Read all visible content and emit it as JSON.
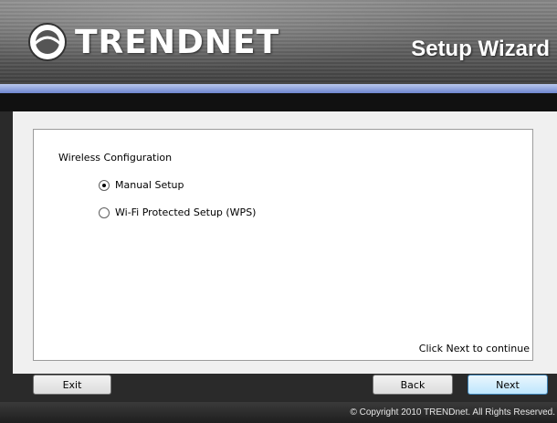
{
  "header": {
    "brand": "TRENDNET",
    "title": "Setup Wizard"
  },
  "wizard": {
    "section_title": "Wireless Configuration",
    "options": [
      {
        "label": "Manual Setup",
        "selected": true
      },
      {
        "label": "Wi-Fi Protected Setup (WPS)",
        "selected": false
      }
    ],
    "hint": "Click Next to continue"
  },
  "buttons": {
    "exit": "Exit",
    "back": "Back",
    "next": "Next"
  },
  "footer": {
    "copyright": "© Copyright 2010 TRENDnet. All Rights Reserved."
  },
  "colors": {
    "accent_bar": "#6f86cf",
    "primary_button_border": "#3c7fb1"
  },
  "icons": {
    "logo": "trendnet-logo-icon"
  }
}
